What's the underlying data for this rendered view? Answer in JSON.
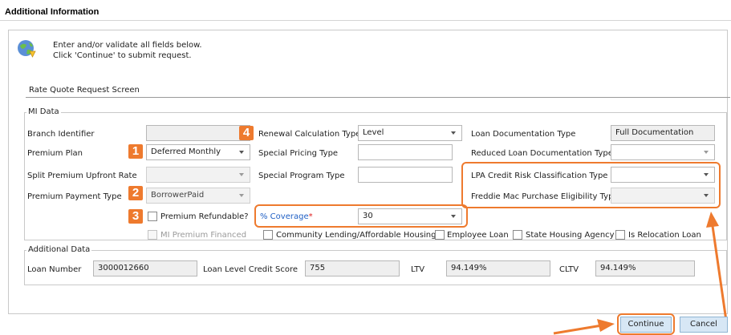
{
  "window_title": "Additional Information",
  "info": {
    "line1": "Enter and/or validate all fields below.",
    "line2": "Click 'Continue' to submit request."
  },
  "screen_tab": "Rate Quote Request Screen",
  "mi_data": {
    "legend": "MI Data",
    "branch_identifier_label": "Branch Identifier",
    "branch_identifier_value": "",
    "premium_plan_label": "Premium Plan",
    "premium_plan_value": "Deferred Monthly",
    "split_premium_label": "Split Premium Upfront Rate",
    "split_premium_value": "",
    "premium_payment_type_label": "Premium Payment Type",
    "premium_payment_type_value": "BorrowerPaid",
    "premium_refundable_label": "Premium Refundable?",
    "mi_premium_financed_label": "MI Premium Financed",
    "renewal_calc_label": "Renewal Calculation Type",
    "renewal_calc_value": "Level",
    "special_pricing_label": "Special Pricing Type",
    "special_pricing_value": "",
    "special_program_label": "Special Program Type",
    "special_program_value": "",
    "coverage_label": "% Coverage",
    "coverage_required": "*",
    "coverage_value": "30",
    "community_lending_label": "Community Lending/Affordable Housing",
    "employee_loan_label": "Employee Loan",
    "state_housing_label": "State Housing Agency",
    "relocation_loan_label": "Is Relocation Loan",
    "loan_doc_type_label": "Loan Documentation Type",
    "loan_doc_type_value": "Full Documentation",
    "reduced_doc_type_label": "Reduced Loan Documentation Type",
    "reduced_doc_type_value": "",
    "lpa_credit_risk_label": "LPA Credit Risk Classification Type",
    "lpa_credit_risk_value": "",
    "freddie_mac_label": "Freddie Mac Purchase Eligibility Type",
    "freddie_mac_value": ""
  },
  "additional_data": {
    "legend": "Additional Data",
    "loan_number_label": "Loan Number",
    "loan_number_value": "3000012660",
    "credit_score_label": "Loan Level Credit Score",
    "credit_score_value": "755",
    "ltv_label": "LTV",
    "ltv_value": "94.149%",
    "cltv_label": "CLTV",
    "cltv_value": "94.149%"
  },
  "callouts": [
    "1",
    "2",
    "3",
    "4"
  ],
  "buttons": {
    "continue": "Continue",
    "cancel": "Cancel"
  },
  "colors": {
    "callout": "#ee7a2e",
    "required": "#e02020",
    "coverage_label": "#1f5fc4",
    "button_bg": "#d7e7f5"
  }
}
